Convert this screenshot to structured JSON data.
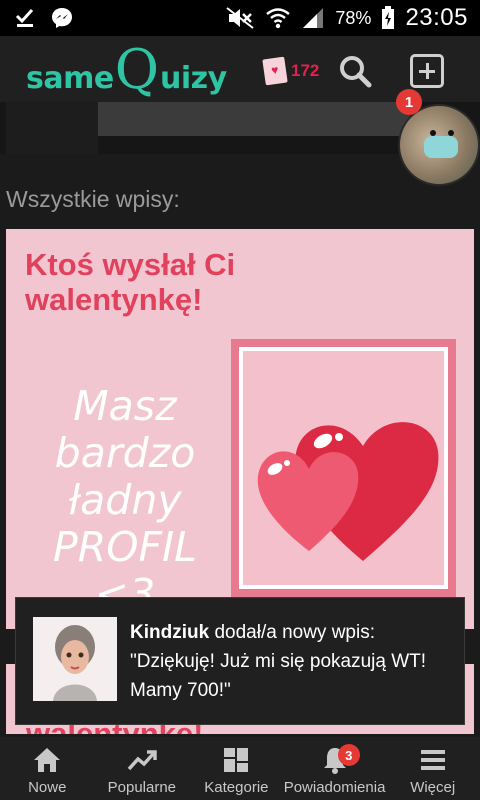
{
  "status_bar": {
    "battery": "78%",
    "time": "23:05",
    "icons": [
      "checkmark-download-icon",
      "messenger-icon",
      "mute-icon",
      "wifi-icon",
      "signal-icon",
      "battery-icon"
    ]
  },
  "header": {
    "logo_parts": [
      "same",
      "Q",
      "uizy"
    ],
    "valentines_count": "172",
    "valentine_icon": "valentine-card-icon",
    "search_icon": "search-icon",
    "add_icon": "add-icon"
  },
  "avatar": {
    "badge_count": "1"
  },
  "feed": {
    "section_title": "Wszystkie wpisy:",
    "post": {
      "title": "Ktoś wysłał Ci walentynkę!",
      "body_lines": [
        "Masz",
        "bardzo",
        "ładny",
        "PROFIL <3"
      ]
    },
    "next_post_title": "walentynkę!"
  },
  "toast": {
    "user": "Kindziuk",
    "action": "dodał/a nowy wpis:",
    "message": "\"Dziękuję! Już mi się pokazują WT! Mamy 700!\""
  },
  "bottom_nav": {
    "items": [
      {
        "label": "Nowe",
        "icon": "home-icon"
      },
      {
        "label": "Popularne",
        "icon": "trending-icon"
      },
      {
        "label": "Kategorie",
        "icon": "categories-icon"
      },
      {
        "label": "Powiadomienia",
        "icon": "bell-icon",
        "badge": "3"
      },
      {
        "label": "Więcej",
        "icon": "menu-icon"
      }
    ]
  },
  "colors": {
    "brand_teal": "#2fc4a4",
    "accent_red": "#e0224e",
    "card_pink": "#f2c6d0"
  }
}
